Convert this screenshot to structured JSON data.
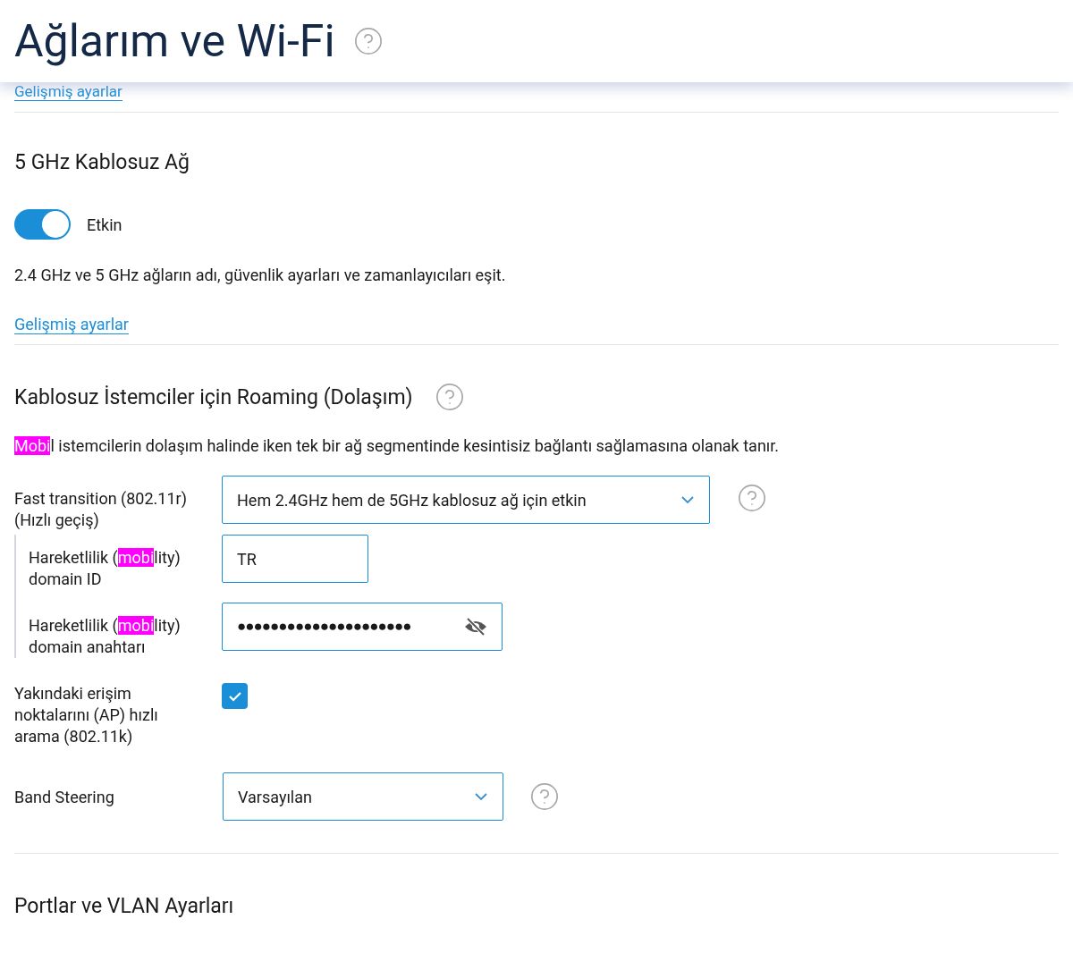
{
  "header": {
    "title": "Ağlarım ve Wi-Fi"
  },
  "top_link": "Gelişmiş ayarlar",
  "band_5ghz": {
    "title": "5 GHz Kablosuz Ağ",
    "toggle": {
      "label": "Etkin",
      "on": true
    },
    "note": "2.4 GHz ve 5 GHz ağların adı, güvenlik ayarları ve zamanlayıcıları eşit.",
    "link": "Gelişmiş ayarlar"
  },
  "roaming": {
    "title": "Kablosuz İstemciler için Roaming (Dolaşım)",
    "description": [
      {
        "text": "Mobi",
        "highlighted": true
      },
      {
        "text": "l istemcilerin dolaşım halinde iken tek bir ağ segmentinde kesintisiz bağlantı sağlamasına olanak tanır.",
        "highlighted": false
      }
    ],
    "fast_transition": {
      "label": "Fast transition (802.11r) (Hızlı geçiş)",
      "value": "Hem 2.4GHz hem de 5GHz kablosuz ağ için etkin"
    },
    "mobility_fields": [
      {
        "kind": "text",
        "label": [
          {
            "text": "Hareketlilik (",
            "highlighted": false
          },
          {
            "text": "mobi",
            "highlighted": true
          },
          {
            "text": "lity) domain ID",
            "highlighted": false
          }
        ],
        "value": "TR"
      },
      {
        "kind": "password",
        "label": [
          {
            "text": "Hareketlilik (",
            "highlighted": false
          },
          {
            "text": "mobi",
            "highlighted": true
          },
          {
            "text": "lity) domain anahtarı",
            "highlighted": false
          }
        ],
        "value": "●●●●●●●●●●●●●●●●●●●●●"
      }
    ],
    "fast_scan": {
      "label": "Yakındaki erişim noktalarını (AP) hızlı arama (802.11k)",
      "checked": true
    },
    "band_steering": {
      "label": "Band Steering",
      "value": "Varsayılan"
    }
  },
  "ports": {
    "title": "Portlar ve VLAN Ayarları"
  }
}
